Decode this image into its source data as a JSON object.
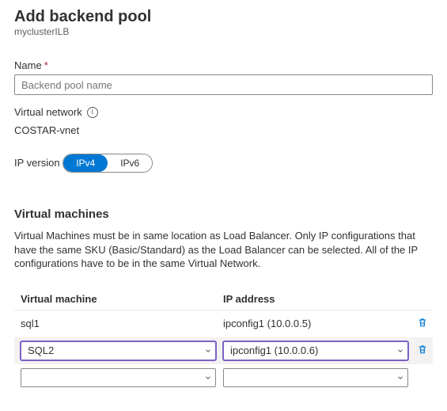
{
  "header": {
    "title": "Add backend pool",
    "subtitle": "myclusterILB"
  },
  "name_field": {
    "label": "Name",
    "required_mark": "*",
    "placeholder": "Backend pool name"
  },
  "vnet": {
    "label": "Virtual network",
    "value": "COSTAR-vnet"
  },
  "ip_version": {
    "label": "IP version",
    "options": {
      "v4": "IPv4",
      "v6": "IPv6"
    }
  },
  "vm_section": {
    "heading": "Virtual machines",
    "description": "Virtual Machines must be in same location as Load Balancer. Only IP configurations that have the same SKU (Basic/Standard) as the Load Balancer can be selected. All of the IP configurations have to be in the same Virtual Network."
  },
  "vm_table": {
    "headers": {
      "vm": "Virtual machine",
      "ip": "IP address"
    },
    "rows": [
      {
        "vm": "sql1",
        "ip": "ipconfig1 (10.0.0.5)",
        "editable": false
      },
      {
        "vm": "SQL2",
        "ip": "ipconfig1 (10.0.0.6)",
        "editable": true
      },
      {
        "vm": "",
        "ip": "",
        "editable": true
      }
    ]
  },
  "icons": {
    "info": "i"
  }
}
